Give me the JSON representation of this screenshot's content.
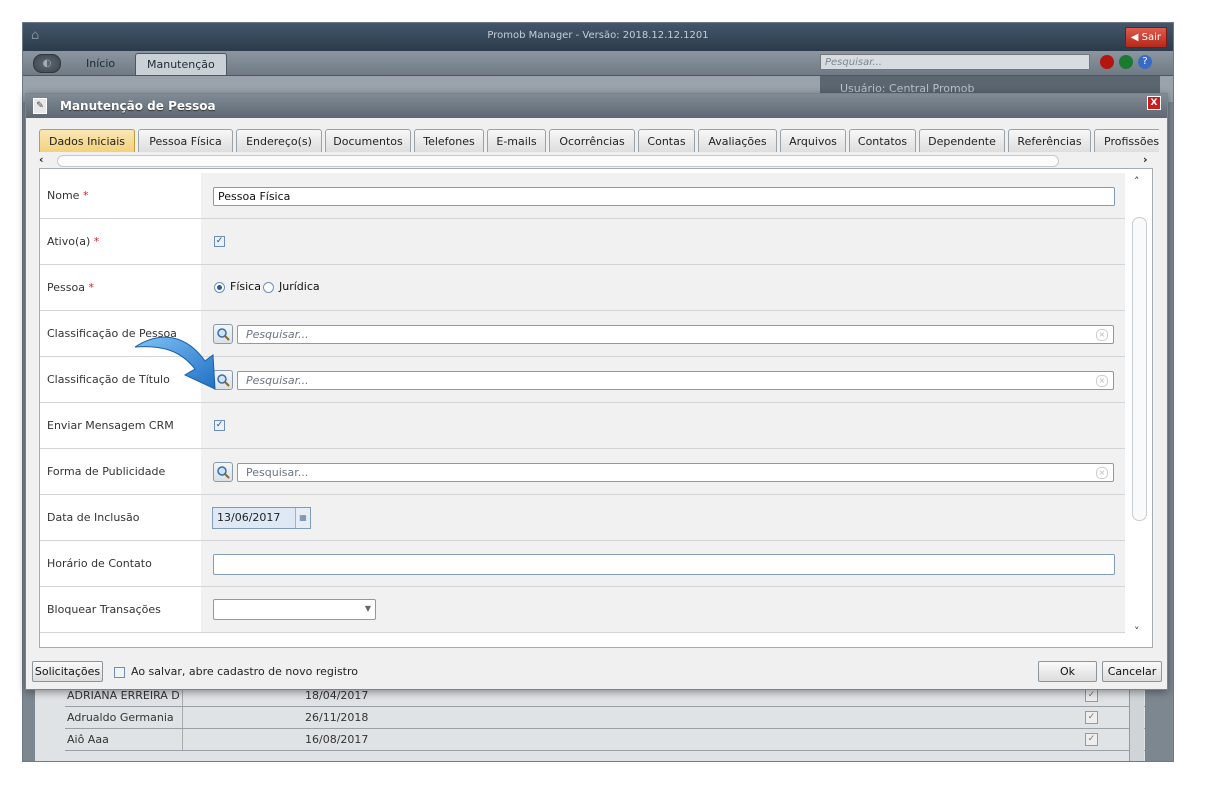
{
  "app": {
    "title": "Promob Manager - Versão: 2018.12.12.1201",
    "exit_label": "Sair",
    "tabs": [
      "Início",
      "Manutenção"
    ],
    "search_placeholder": "Pesquisar...",
    "user_text": "Usuário: Central Promob"
  },
  "background_rows": [
    {
      "name": "ADRIANA ERREIRA D",
      "date": "18/04/2017"
    },
    {
      "name": "Adrualdo Germania",
      "date": "26/11/2018"
    },
    {
      "name": "Aiô Aaa",
      "date": "16/08/2017"
    }
  ],
  "dialog": {
    "title": "Manutenção de Pessoa",
    "close_label": "X",
    "tabs": [
      {
        "label": "Dados Iniciais",
        "active": true
      },
      {
        "label": "Pessoa Física"
      },
      {
        "label": "Endereço(s)"
      },
      {
        "label": "Documentos"
      },
      {
        "label": "Telefones"
      },
      {
        "label": "E-mails"
      },
      {
        "label": "Ocorrências"
      },
      {
        "label": "Contas"
      },
      {
        "label": "Avaliações"
      },
      {
        "label": "Arquivos"
      },
      {
        "label": "Contatos"
      },
      {
        "label": "Dependente"
      },
      {
        "label": "Referências"
      },
      {
        "label": "Profissões"
      }
    ],
    "fields": {
      "nome": {
        "label": "Nome",
        "required": "*",
        "value": "Pessoa Física"
      },
      "ativo": {
        "label": "Ativo(a)",
        "required": "*",
        "checked": true
      },
      "pessoa": {
        "label": "Pessoa",
        "required": "*",
        "options": [
          "Física",
          "Jurídica"
        ],
        "selected": "Física"
      },
      "classificacao_pessoa": {
        "label": "Classificação de Pessoa",
        "placeholder": "Pesquisar..."
      },
      "classificacao_titulo": {
        "label": "Classificação de Título",
        "placeholder": "Pesquisar..."
      },
      "enviar_crm": {
        "label": "Enviar Mensagem CRM",
        "checked": true
      },
      "forma_publicidade": {
        "label": "Forma de Publicidade",
        "placeholder": "Pesquisar..."
      },
      "data_inclusao": {
        "label": "Data de Inclusão",
        "value": "13/06/2017"
      },
      "horario_contato": {
        "label": "Horário de Contato",
        "value": ""
      },
      "bloquear_transacoes": {
        "label": "Bloquear Transações",
        "value": ""
      }
    },
    "footer": {
      "solicitacoes": "Solicitações",
      "checkbox_label": "Ao salvar, abre cadastro de novo registro",
      "ok": "Ok",
      "cancel": "Cancelar"
    }
  },
  "colors": {
    "active_tab": "#f3d27a",
    "required": "#d62020",
    "arrow": "#2b8ad8"
  }
}
